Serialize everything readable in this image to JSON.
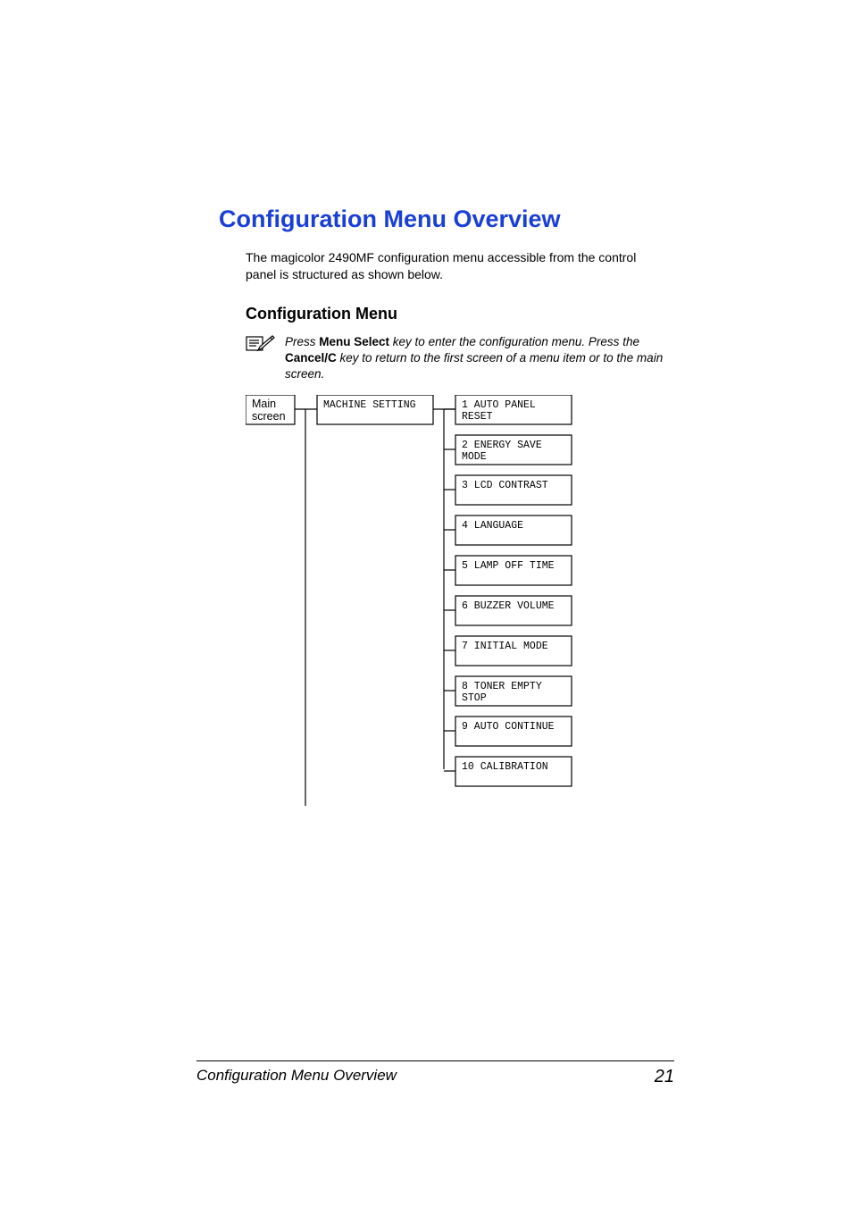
{
  "title": "Configuration Menu Overview",
  "intro": "The magicolor 2490MF configuration menu accessible from the control panel is structured as shown below.",
  "section_heading": "Configuration Menu",
  "note": {
    "part1": "Press ",
    "bold1": "Menu Select",
    "part2": " key to enter the configuration menu. Press the ",
    "bold2": "Cancel/C",
    "part3": " key to return to the first screen of a menu item or to the main screen."
  },
  "diagram": {
    "main": {
      "line1": "Main",
      "line2": "screen"
    },
    "level1": "MACHINE SETTING",
    "items": [
      {
        "line1": "1 AUTO PANEL",
        "line2": "RESET"
      },
      {
        "line1": "2 ENERGY SAVE",
        "line2": "MODE"
      },
      {
        "line1": "3 LCD CONTRAST",
        "line2": ""
      },
      {
        "line1": "4 LANGUAGE",
        "line2": ""
      },
      {
        "line1": "5 LAMP OFF TIME",
        "line2": ""
      },
      {
        "line1": "6 BUZZER VOLUME",
        "line2": ""
      },
      {
        "line1": "7 INITIAL MODE",
        "line2": ""
      },
      {
        "line1": "8 TONER EMPTY",
        "line2": "STOP"
      },
      {
        "line1": "9 AUTO CONTINUE",
        "line2": ""
      },
      {
        "line1": "10 CALIBRATION",
        "line2": ""
      }
    ]
  },
  "footer": {
    "title": "Configuration Menu Overview",
    "page": "21"
  }
}
